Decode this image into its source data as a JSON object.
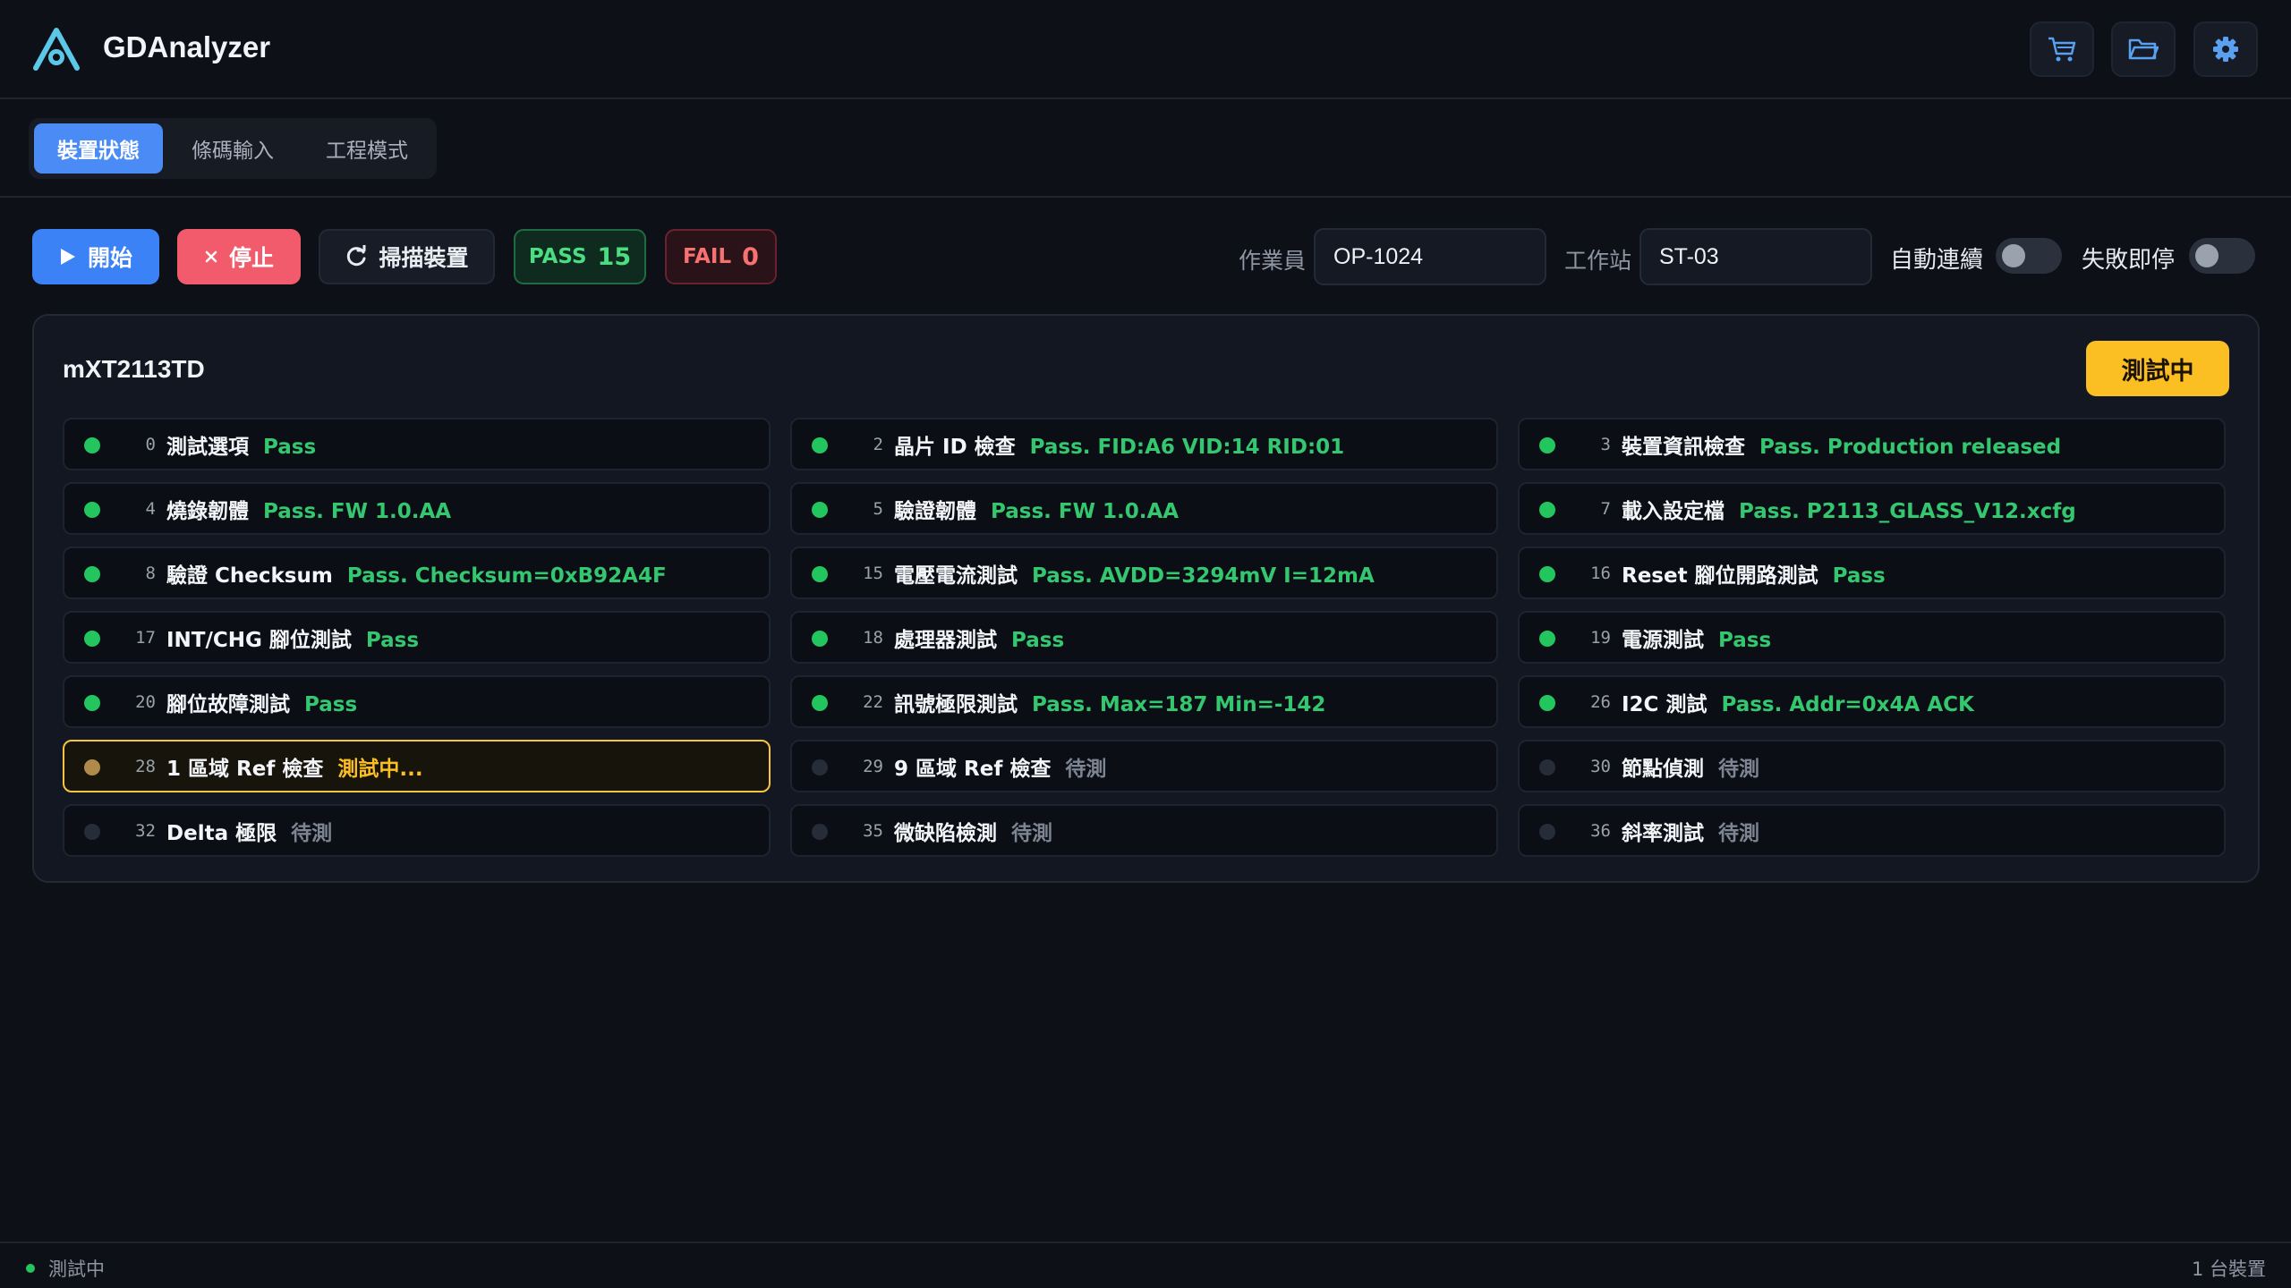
{
  "app": {
    "title": "GDAnalyzer"
  },
  "header_buttons": [
    {
      "icon": "cart-icon"
    },
    {
      "icon": "folder-icon"
    },
    {
      "icon": "gear-icon"
    }
  ],
  "tabs": [
    {
      "label": "裝置狀態",
      "active": true
    },
    {
      "label": "條碼輸入",
      "active": false
    },
    {
      "label": "工程模式",
      "active": false
    }
  ],
  "toolbar": {
    "start_label": "開始",
    "stop_label": "停止",
    "scan_label": "掃描裝置",
    "pass_label": "PASS",
    "pass_count": "15",
    "fail_label": "FAIL",
    "fail_count": "0",
    "operator_label": "作業員",
    "operator_value": "OP-1024",
    "station_label": "工作站",
    "station_value": "ST-03",
    "auto_continue_label": "自動連續",
    "auto_continue_on": false,
    "stop_on_fail_label": "失敗即停",
    "stop_on_fail_on": false
  },
  "device": {
    "name": "mXT2113TD",
    "status": "測試中",
    "tests": [
      {
        "num": "0",
        "name": "測試選項",
        "result": "Pass",
        "state": "pass"
      },
      {
        "num": "2",
        "name": "晶片 ID 檢查",
        "result": "Pass. FID:A6 VID:14 RID:01",
        "state": "pass"
      },
      {
        "num": "3",
        "name": "裝置資訊檢查",
        "result": "Pass. Production released",
        "state": "pass"
      },
      {
        "num": "4",
        "name": "燒錄韌體",
        "result": "Pass. FW 1.0.AA",
        "state": "pass"
      },
      {
        "num": "5",
        "name": "驗證韌體",
        "result": "Pass. FW 1.0.AA",
        "state": "pass"
      },
      {
        "num": "7",
        "name": "載入設定檔",
        "result": "Pass. P2113_GLASS_V12.xcfg",
        "state": "pass"
      },
      {
        "num": "8",
        "name": "驗證 Checksum",
        "result": "Pass. Checksum=0xB92A4F",
        "state": "pass"
      },
      {
        "num": "15",
        "name": "電壓電流測試",
        "result": "Pass. AVDD=3294mV I=12mA",
        "state": "pass"
      },
      {
        "num": "16",
        "name": "Reset 腳位開路測試",
        "result": "Pass",
        "state": "pass"
      },
      {
        "num": "17",
        "name": "INT/CHG 腳位測試",
        "result": "Pass",
        "state": "pass"
      },
      {
        "num": "18",
        "name": "處理器測試",
        "result": "Pass",
        "state": "pass"
      },
      {
        "num": "19",
        "name": "電源測試",
        "result": "Pass",
        "state": "pass"
      },
      {
        "num": "20",
        "name": "腳位故障測試",
        "result": "Pass",
        "state": "pass"
      },
      {
        "num": "22",
        "name": "訊號極限測試",
        "result": "Pass. Max=187 Min=-142",
        "state": "pass"
      },
      {
        "num": "26",
        "name": "I2C 測試",
        "result": "Pass. Addr=0x4A ACK",
        "state": "pass"
      },
      {
        "num": "28",
        "name": "1 區域 Ref 檢查",
        "result": "測試中...",
        "state": "running"
      },
      {
        "num": "29",
        "name": "9 區域 Ref 檢查",
        "result": "待測",
        "state": "waiting"
      },
      {
        "num": "30",
        "name": "節點偵測",
        "result": "待測",
        "state": "waiting"
      },
      {
        "num": "32",
        "name": "Delta 極限",
        "result": "待測",
        "state": "waiting"
      },
      {
        "num": "35",
        "name": "微缺陷檢測",
        "result": "待測",
        "state": "waiting"
      },
      {
        "num": "36",
        "name": "斜率測試",
        "result": "待測",
        "state": "waiting"
      }
    ]
  },
  "statusbar": {
    "status_text": "測試中",
    "device_count": "1 台裝置"
  },
  "colors": {
    "accent": "#3b82f6",
    "pass": "#22c55e",
    "fail": "#f87171",
    "running": "#fbbf24",
    "background": "#0d1017"
  }
}
